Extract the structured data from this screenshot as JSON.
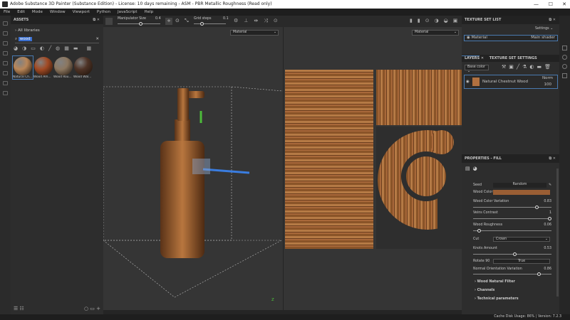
{
  "window": {
    "title": "Adobe Substance 3D Painter (Substance Edition) - License: 10 days remaining - ASM - PBR Metallic Roughness (Read only)",
    "minimize": "—",
    "maximize": "☐",
    "close": "✕"
  },
  "menu": [
    "File",
    "Edit",
    "Mode",
    "Window",
    "Viewport",
    "Python",
    "JavaScript",
    "Help"
  ],
  "assets": {
    "title": "ASSETS",
    "breadcrumb": "All libraries",
    "search_value": "wood",
    "items": [
      {
        "label": "Natural Ch...",
        "color": "#b98658"
      },
      {
        "label": "Wood Am...",
        "color": "#a24a24"
      },
      {
        "label": "Wood Rou...",
        "color": "#8c7760"
      },
      {
        "label": "Wood Wal...",
        "color": "#4e3326"
      }
    ]
  },
  "toolbar": {
    "manipulator_label": "Manipulator Size",
    "manipulator_value": "0.4",
    "grid_label": "Grid steps",
    "grid_value": "0.1",
    "manipulator_fraction": 0.4,
    "grid_fraction": 0.1
  },
  "viewport": {
    "left_mode": "Material",
    "right_mode": "Material"
  },
  "texture_set_list": {
    "title": "TEXTURE SET LIST",
    "settings": "Settings",
    "material": "Material",
    "shader": "Main shader"
  },
  "layers": {
    "tab": "LAYERS",
    "tab2": "TEXTURE SET SETTINGS",
    "channel": "Base color",
    "layer_name": "Natural Chestnut Wood",
    "blend": "Norm",
    "opacity": "100"
  },
  "properties": {
    "title": "PROPERTIES - FILL",
    "seed_label": "Seed",
    "seed_value": "Random",
    "wood_color_label": "Wood Color",
    "wood_color": "#9a5e34",
    "sliders": [
      {
        "label": "Wood Color Variation",
        "value": "0.83",
        "fraction": 0.83
      },
      {
        "label": "Veins Contrast",
        "value": "1",
        "fraction": 1
      },
      {
        "label": "Wood Roughness",
        "value": "0.06",
        "fraction": 0.06
      }
    ],
    "cut_label": "Cut",
    "cut_value": "Crown",
    "knots": {
      "label": "Knots Amount",
      "value": "0.53",
      "fraction": 0.53
    },
    "rotate_label": "Rotate 90",
    "rotate_value": "True",
    "normal": {
      "label": "Normal Orientation Variation",
      "value": "0.86",
      "fraction": 0.86
    },
    "sections": [
      "Wood Natural Filter",
      "Channels",
      "Technical parameters"
    ]
  },
  "status": "Cache Disk Usage:   86% | Version: 7.2.3"
}
